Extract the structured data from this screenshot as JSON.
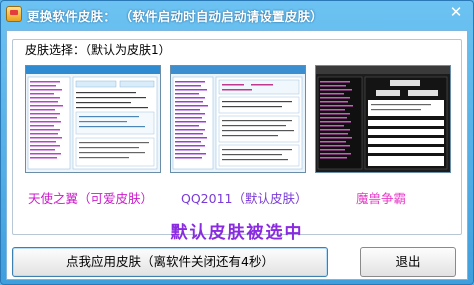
{
  "window": {
    "title": "更换软件皮肤：",
    "title_hint": "（软件启动时自动启动请设置皮肤）",
    "close_glyph": "✕"
  },
  "skin_group": {
    "label": "皮肤选择：（默认为皮肤1）",
    "skins": [
      {
        "name": "天使之翼（可爱皮肤）",
        "color": "#cc1bcc",
        "theme": "light-blue"
      },
      {
        "name": "QQ2011（默认皮肤）",
        "color": "#7a3bd6",
        "theme": "light-blue"
      },
      {
        "name": "魔兽争霸",
        "color": "#e63bc8",
        "theme": "dark"
      }
    ]
  },
  "status_text": "默认皮肤被选中",
  "buttons": {
    "apply": "点我应用皮肤（离软件关闭还有4秒）",
    "exit": "退出"
  },
  "colors": {
    "status": "#8a2be2",
    "titlebar": "#4aa9e6"
  }
}
